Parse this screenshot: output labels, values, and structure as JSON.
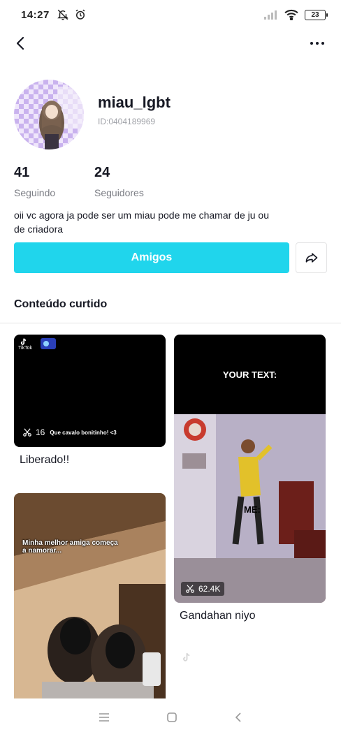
{
  "status_bar": {
    "time": "14:27",
    "battery": "23",
    "icons": [
      "muted-bell-icon",
      "alarm-icon",
      "signal-icon",
      "wifi-icon",
      "battery-icon"
    ]
  },
  "nav": {
    "back_icon": "back-chevron-icon",
    "more_icon": "more-dots-icon"
  },
  "profile": {
    "username": "miau_lgbt",
    "id_text": "ID:0404189969",
    "following_count": "41",
    "following_label": "Seguindo",
    "followers_count": "24",
    "followers_label": "Seguidores",
    "bio": "oii vc agora ja pode ser um miau pode me chamar de ju ou de criadora"
  },
  "actions": {
    "friends_label": "Amigos",
    "share_icon": "share-arrow-icon"
  },
  "liked": {
    "title": "Conteúdo curtido",
    "videos": [
      {
        "caption": "Liberado!!",
        "count": "16",
        "overlay_text": "Que cavalo bonitinho! <3",
        "watermark": "TikTok"
      },
      {
        "caption": "",
        "count": "",
        "overlay_text": "Minha melhor amiga começa a namorar..."
      },
      {
        "caption": "Gandahan niyo",
        "count": "62.4K",
        "overlay_top": "YOUR TEXT:",
        "overlay_mid": "ME:"
      }
    ]
  },
  "colors": {
    "accent": "#20d5ec",
    "text": "#161823",
    "secondary": "#7c7e85"
  },
  "system_nav": [
    "menu-icon",
    "home-square-icon",
    "back-triangle-icon"
  ]
}
